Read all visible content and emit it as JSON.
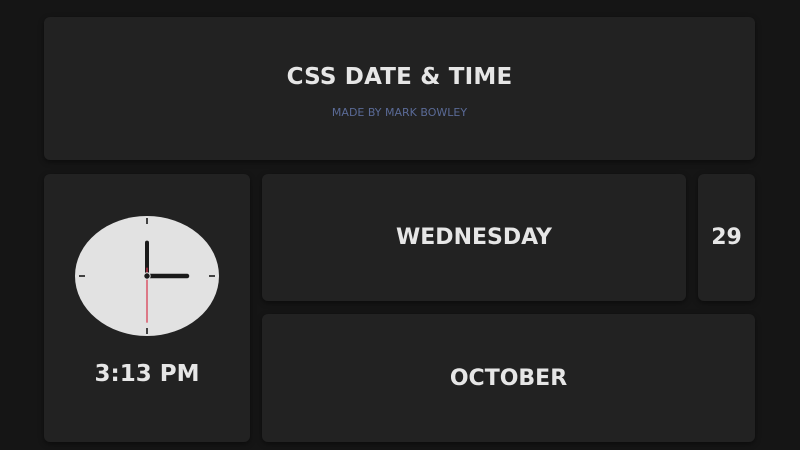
{
  "header": {
    "title": "CSS DATE & TIME",
    "subtitle": "MADE BY MARK BOWLEY"
  },
  "clock": {
    "time_label": "3:13 PM",
    "hour": 3,
    "minute": 13,
    "second": 30,
    "face_color": "#e2e2e2",
    "hand_color": "#1a1a1a",
    "second_hand_color": "#d8314a"
  },
  "date": {
    "weekday": "WEDNESDAY",
    "day": "29",
    "month": "OCTOBER"
  }
}
